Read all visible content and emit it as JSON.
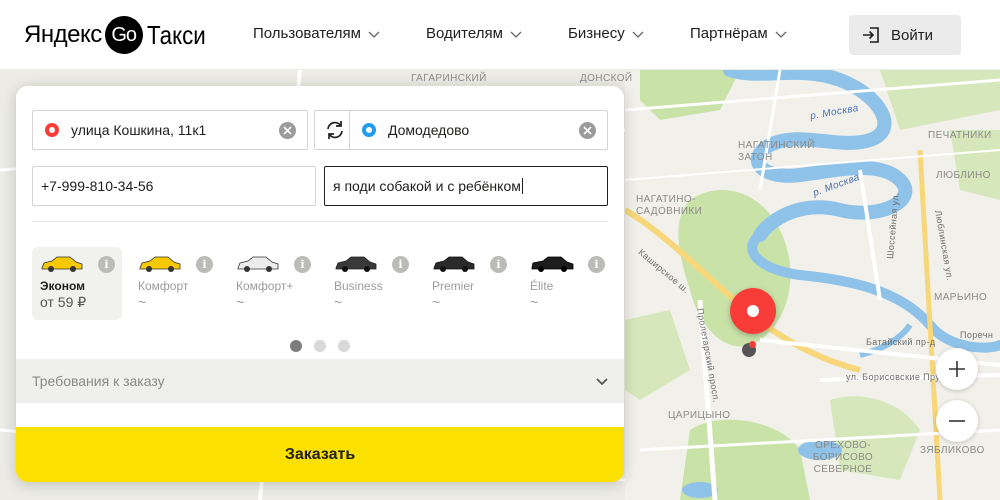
{
  "header": {
    "logo": {
      "yandex": "Яндекс",
      "go": "Go",
      "taxi": "Такси"
    },
    "nav": [
      {
        "label": "Пользователям"
      },
      {
        "label": "Водителям"
      },
      {
        "label": "Бизнесу"
      },
      {
        "label": "Партнёрам"
      }
    ],
    "login_label": "Войти"
  },
  "order_form": {
    "from_value": "улица Кошкина, 11к1",
    "to_value": "Домодедово",
    "phone_value": "+7-999-810-34-56",
    "comment_value": "я поди собакой и с ребёнком",
    "tariffs": [
      {
        "name": "Эконом",
        "price": "от 59 ₽",
        "selected": true,
        "car_color": "#f6c900"
      },
      {
        "name": "Комфорт",
        "price": "~",
        "selected": false,
        "car_color": "#f6c900"
      },
      {
        "name": "Комфорт+",
        "price": "~",
        "selected": false,
        "car_color": "#ececec"
      },
      {
        "name": "Business",
        "price": "~",
        "selected": false,
        "car_color": "#3a3a3a"
      },
      {
        "name": "Premier",
        "price": "~",
        "selected": false,
        "car_color": "#2a2a2a"
      },
      {
        "name": "Élite",
        "price": "~",
        "selected": false,
        "car_color": "#1d1d1d"
      }
    ],
    "info_glyph": "i",
    "pager_active_index": 0,
    "requirements_label": "Требования к заказу",
    "order_button_label": "Заказать"
  },
  "map": {
    "labels": [
      {
        "text": "ГАГАРИНСКИЙ",
        "kind": "district"
      },
      {
        "text": "ДОНСКОЙ",
        "kind": "district"
      },
      {
        "text": "р. Москва",
        "kind": "river"
      },
      {
        "text": "НАГАТИНСКИЙ ЗАТОН",
        "kind": "district"
      },
      {
        "text": "р. Москва",
        "kind": "river"
      },
      {
        "text": "НАГАТИНО-САДОВНИКИ",
        "kind": "district"
      },
      {
        "text": "ПЕЧАТНИКИ",
        "kind": "district"
      },
      {
        "text": "ЛЮБЛИНО",
        "kind": "district"
      },
      {
        "text": "Каширское ш.",
        "kind": "road"
      },
      {
        "text": "Шоссейная ул.",
        "kind": "road"
      },
      {
        "text": "Люблинская ул.",
        "kind": "road"
      },
      {
        "text": "МАРЬИНО",
        "kind": "district"
      },
      {
        "text": "Пролетарский просп.",
        "kind": "road"
      },
      {
        "text": "Батайский пр-д",
        "kind": "road"
      },
      {
        "text": "ул. Борисовские Пруды",
        "kind": "road"
      },
      {
        "text": "Поречн",
        "kind": "road"
      },
      {
        "text": "ЦАРИЦЫНО",
        "kind": "district"
      },
      {
        "text": "ОРЕХОВО-БОРИСОВО СЕВЕРНОЕ",
        "kind": "district"
      },
      {
        "text": "ЗЯБЛИКОВО",
        "kind": "district"
      }
    ],
    "zoom_in": "+",
    "zoom_out": "−",
    "colors": {
      "water": "#8fc2e8",
      "park": "#c9e2a8",
      "road": "#ffffff",
      "highway": "#f7d77a"
    }
  }
}
